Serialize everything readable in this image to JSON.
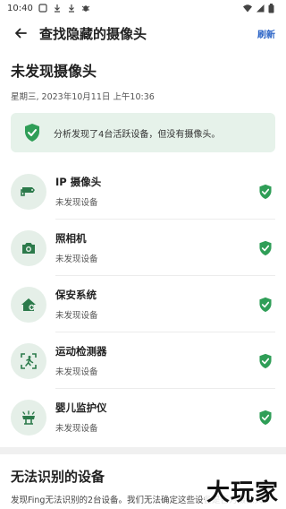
{
  "status_bar": {
    "time": "10:40"
  },
  "app_bar": {
    "title": "查找隐藏的摄像头",
    "refresh_label": "刷新"
  },
  "main": {
    "section_title": "未发现摄像头",
    "timestamp": "星期三, 2023年10月11日 上午10:36",
    "summary": "分析发现了4台活跃设备，但没有摄像头。",
    "devices": [
      {
        "name": "IP 摄像头",
        "status": "未发现设备",
        "icon": "ip-camera-icon"
      },
      {
        "name": "照相机",
        "status": "未发现设备",
        "icon": "photo-camera-icon"
      },
      {
        "name": "保安系统",
        "status": "未发现设备",
        "icon": "home-security-icon"
      },
      {
        "name": "运动检测器",
        "status": "未发现设备",
        "icon": "motion-sensor-icon"
      },
      {
        "name": "婴儿监护仪",
        "status": "未发现设备",
        "icon": "baby-monitor-icon"
      }
    ]
  },
  "unidentified": {
    "title": "无法识别的设备",
    "description": "发现Fing无法识别的2台设备。我们无法确定这些设备是否为摄像头。"
  },
  "watermark": "大玩家",
  "colors": {
    "accent_green": "#2f9e57",
    "icon_green": "#2c7a4b",
    "card_bg": "#e6f2ea",
    "link_blue": "#2a63c6"
  }
}
